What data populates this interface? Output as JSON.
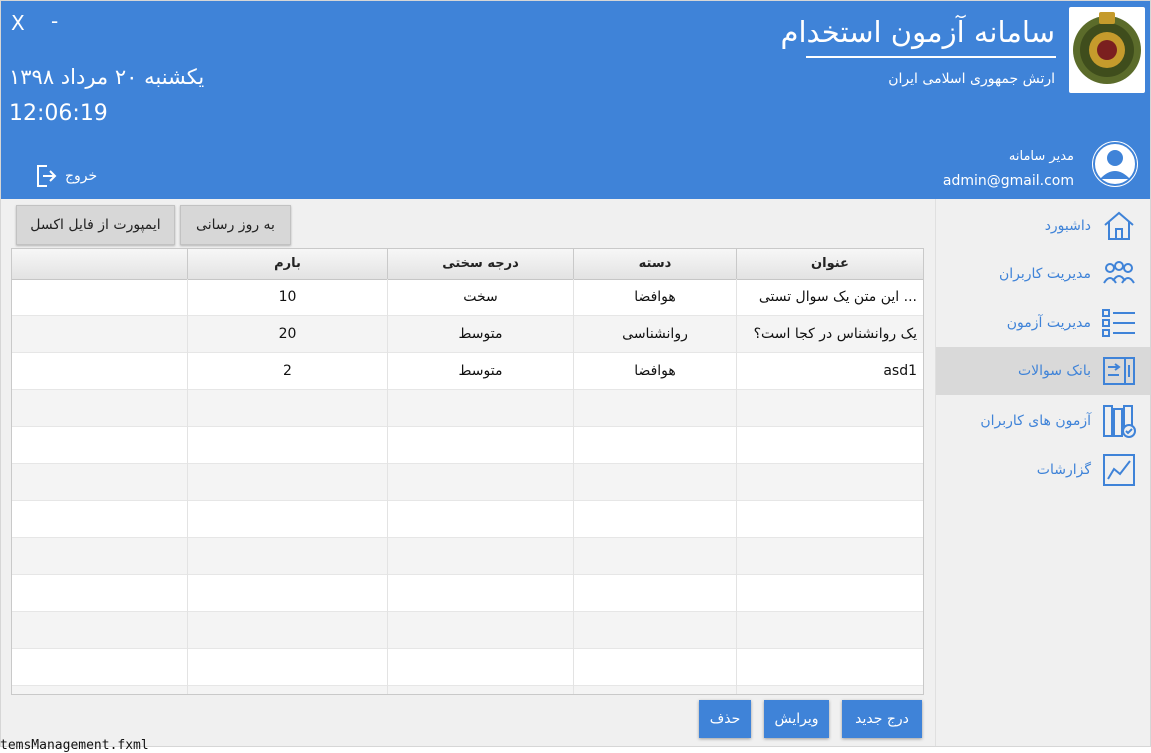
{
  "window": {
    "close": "X",
    "minimize": "-"
  },
  "header": {
    "app_title": "سامانه آزمون استخدام",
    "organization": "ارتش جمهوری اسلامی ایران",
    "date": "یکشنبه ۲۰ مرداد ۱۳۹۸",
    "time": "12:06:19",
    "logout_label": "خروج",
    "user_role": "مدیر سامانه",
    "user_email": "admin@gmail.com"
  },
  "sidebar": {
    "items": [
      {
        "label": "داشبورد",
        "icon": "home-icon"
      },
      {
        "label": "مدیریت کاربران",
        "icon": "users-icon"
      },
      {
        "label": "مدیریت آزمون",
        "icon": "list-icon"
      },
      {
        "label": "بانک سوالات",
        "icon": "question-bank-icon"
      },
      {
        "label": "آزمون های کاربران",
        "icon": "user-exams-icon"
      },
      {
        "label": "گزارشات",
        "icon": "report-chart-icon"
      }
    ]
  },
  "toolbar": {
    "refresh_label": "به روز رسانی",
    "import_excel_label": "ایمپورت از فایل اکسل"
  },
  "table": {
    "columns": [
      "عنوان",
      "دسته",
      "درجه سختی",
      "بارم",
      ""
    ],
    "rows": [
      [
        "این متن یک سوال تستی ...",
        "هوافضا",
        "سخت",
        "10",
        ""
      ],
      [
        "یک روانشناس در کجا است؟",
        "روانشناسی",
        "متوسط",
        "20",
        ""
      ],
      [
        "asd1",
        "هوافضا",
        "متوسط",
        "2",
        ""
      ]
    ]
  },
  "actions": {
    "new_label": "درج جدید",
    "edit_label": "ویرایش",
    "delete_label": "حذف"
  },
  "bottom_text": "temsManagement.fxml",
  "colors": {
    "accent": "#3f83d8",
    "active_nav": "#d9d9d9"
  }
}
